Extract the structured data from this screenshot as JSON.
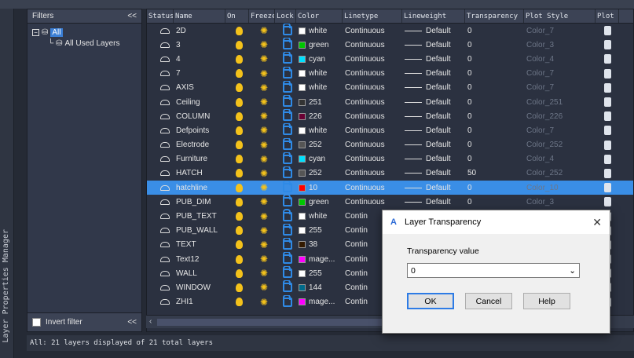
{
  "window": {
    "top_strip_text": "Layer Properties Manager",
    "vertical_title": "Layer Properties Manager"
  },
  "filters": {
    "header": "Filters",
    "collapse": "<<",
    "tree": [
      {
        "label": "All",
        "selected": true
      },
      {
        "label": "All Used Layers",
        "selected": false
      }
    ],
    "invert_filter_label": "Invert filter",
    "footer_collapse": "<<"
  },
  "grid": {
    "columns": [
      "Status",
      "Name",
      "On",
      "Freeze",
      "Lock",
      "Color",
      "Linetype",
      "Lineweight",
      "Transparency",
      "Plot Style",
      "Plot"
    ],
    "rows": [
      {
        "name": "2D",
        "color_name": "white",
        "color": "#ffffff",
        "linetype": "Continuous",
        "lineweight": "Default",
        "transparency": "0",
        "plot_style": "Color_7"
      },
      {
        "name": "3",
        "color_name": "green",
        "color": "#00c800",
        "linetype": "Continuous",
        "lineweight": "Default",
        "transparency": "0",
        "plot_style": "Color_3"
      },
      {
        "name": "4",
        "color_name": "cyan",
        "color": "#00e0ff",
        "linetype": "Continuous",
        "lineweight": "Default",
        "transparency": "0",
        "plot_style": "Color_4"
      },
      {
        "name": "7",
        "color_name": "white",
        "color": "#ffffff",
        "linetype": "Continuous",
        "lineweight": "Default",
        "transparency": "0",
        "plot_style": "Color_7"
      },
      {
        "name": "AXIS",
        "color_name": "white",
        "color": "#ffffff",
        "linetype": "Continuous",
        "lineweight": "Default",
        "transparency": "0",
        "plot_style": "Color_7"
      },
      {
        "name": "Ceiling",
        "color_name": "251",
        "color": "#333333",
        "linetype": "Continuous",
        "lineweight": "Default",
        "transparency": "0",
        "plot_style": "Color_251"
      },
      {
        "name": "COLUMN",
        "color_name": "226",
        "color": "#6a0033",
        "linetype": "Continuous",
        "lineweight": "Default",
        "transparency": "0",
        "plot_style": "Color_226"
      },
      {
        "name": "Defpoints",
        "color_name": "white",
        "color": "#ffffff",
        "linetype": "Continuous",
        "lineweight": "Default",
        "transparency": "0",
        "plot_style": "Color_7"
      },
      {
        "name": "Electrode",
        "color_name": "252",
        "color": "#555555",
        "linetype": "Continuous",
        "lineweight": "Default",
        "transparency": "0",
        "plot_style": "Color_252"
      },
      {
        "name": "Furniture",
        "color_name": "cyan",
        "color": "#00e0ff",
        "linetype": "Continuous",
        "lineweight": "Default",
        "transparency": "0",
        "plot_style": "Color_4"
      },
      {
        "name": "HATCH",
        "color_name": "252",
        "color": "#555555",
        "linetype": "Continuous",
        "lineweight": "Default",
        "transparency": "50",
        "plot_style": "Color_252"
      },
      {
        "name": "hatchline",
        "color_name": "10",
        "color": "#ff0000",
        "linetype": "Continuous",
        "lineweight": "Default",
        "transparency": "0",
        "plot_style": "Color_10",
        "selected": true
      },
      {
        "name": "PUB_DIM",
        "color_name": "green",
        "color": "#00c800",
        "linetype": "Continuous",
        "lineweight": "Default",
        "transparency": "0",
        "plot_style": "Color_3"
      },
      {
        "name": "PUB_TEXT",
        "color_name": "white",
        "color": "#ffffff",
        "linetype": "Contin",
        "lineweight": "",
        "transparency": "",
        "plot_style": ""
      },
      {
        "name": "PUB_WALL",
        "color_name": "255",
        "color": "#ffffff",
        "linetype": "Contin",
        "lineweight": "",
        "transparency": "",
        "plot_style": ""
      },
      {
        "name": "TEXT",
        "color_name": "38",
        "color": "#331a00",
        "linetype": "Contin",
        "lineweight": "",
        "transparency": "",
        "plot_style": ""
      },
      {
        "name": "Text12",
        "color_name": "mage...",
        "color": "#ff00ff",
        "linetype": "Contin",
        "lineweight": "",
        "transparency": "",
        "plot_style": ""
      },
      {
        "name": "WALL",
        "color_name": "255",
        "color": "#ffffff",
        "linetype": "Contin",
        "lineweight": "",
        "transparency": "",
        "plot_style": ""
      },
      {
        "name": "WINDOW",
        "color_name": "144",
        "color": "#006a8a",
        "linetype": "Contin",
        "lineweight": "",
        "transparency": "",
        "plot_style": ""
      },
      {
        "name": "ZHI1",
        "color_name": "mage...",
        "color": "#ff00ff",
        "linetype": "Contin",
        "lineweight": "",
        "transparency": "",
        "plot_style": ""
      }
    ]
  },
  "statusbar": {
    "text": "All:  21 layers displayed of 21 total layers"
  },
  "dialog": {
    "title": "Layer Transparency",
    "label": "Transparency value",
    "value": "0",
    "ok": "OK",
    "cancel": "Cancel",
    "help": "Help"
  },
  "icons": {
    "status": "layer-status-icon",
    "on": "lightbulb-icon",
    "freeze": "sun-icon",
    "lock": "unlock-icon",
    "plot": "printer-icon"
  }
}
